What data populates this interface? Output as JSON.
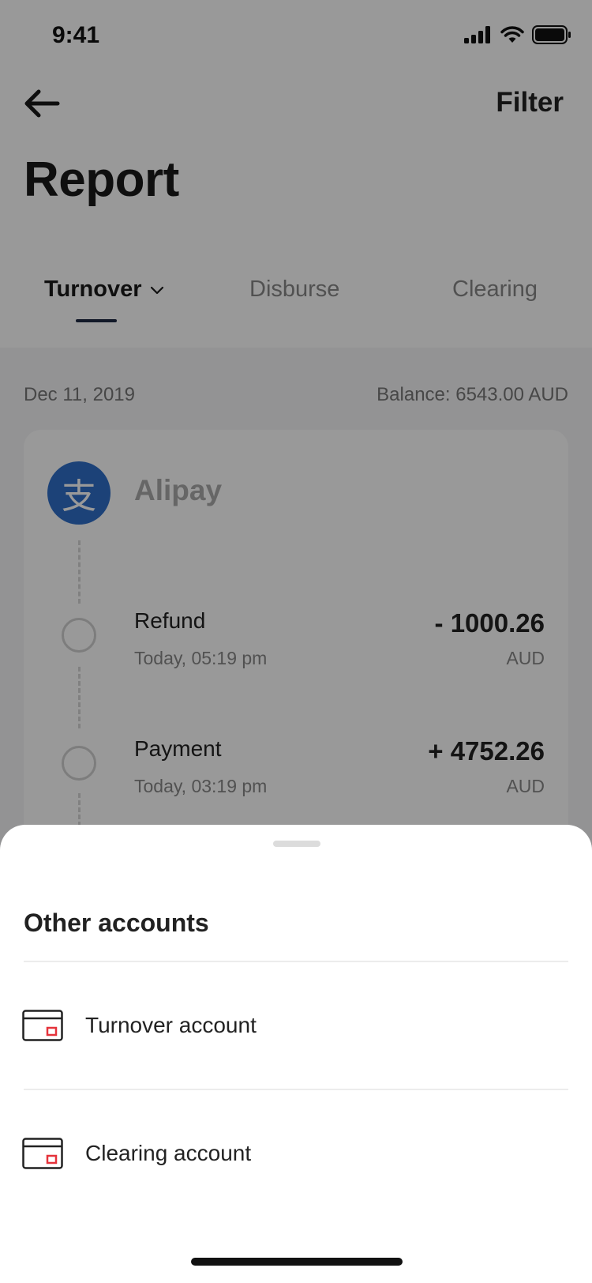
{
  "status_bar": {
    "time": "9:41"
  },
  "header": {
    "back_icon": "arrow-left-icon",
    "filter_label": "Filter",
    "title": "Report"
  },
  "tabs": [
    {
      "label": "Turnover",
      "active": true,
      "icon": "chevron-down-icon"
    },
    {
      "label": "Disburse",
      "active": false
    },
    {
      "label": "Clearing",
      "active": false
    }
  ],
  "summary": {
    "date": "Dec 11, 2019",
    "balance": "Balance: 6543.00 AUD"
  },
  "card": {
    "provider_name": "Alipay",
    "provider_glyph": "支",
    "transactions": [
      {
        "label": "Refund",
        "time": "Today, 05:19 pm",
        "amount": "- 1000.26",
        "currency": "AUD"
      },
      {
        "label": "Payment",
        "time": "Today, 03:19 pm",
        "amount": "+ 4752.26",
        "currency": "AUD"
      }
    ]
  },
  "sheet": {
    "title": "Other accounts",
    "items": [
      {
        "label": "Turnover account",
        "icon": "account-card-icon"
      },
      {
        "label": "Clearing account",
        "icon": "account-card-icon"
      }
    ]
  },
  "colors": {
    "accent": "#1f2a44",
    "alipay": "#2f6fc9",
    "icon_highlight": "#e5333b"
  }
}
